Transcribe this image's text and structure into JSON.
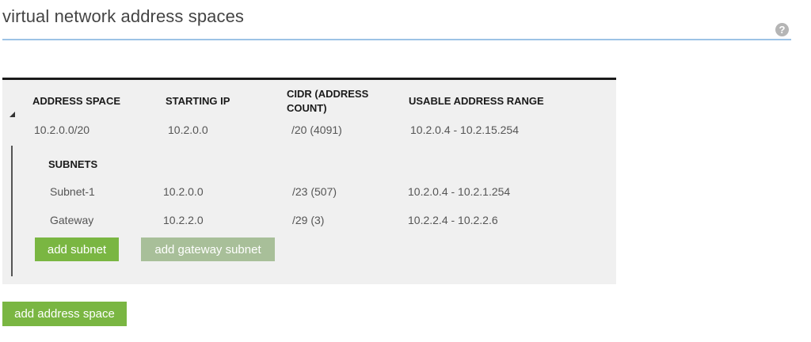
{
  "header": {
    "title": "virtual network address spaces",
    "help_icon": "?"
  },
  "colors": {
    "accent_line": "#9cc3e5",
    "button_green": "#7ab642",
    "button_disabled": "#a8bf99",
    "panel_bg": "#f0f0f0"
  },
  "table": {
    "columns": [
      "ADDRESS SPACE",
      "STARTING IP",
      "CIDR (ADDRESS COUNT)",
      "USABLE ADDRESS RANGE"
    ],
    "address_space": {
      "address": "10.2.0.0/20",
      "starting_ip": "10.2.0.0",
      "cidr": "/20 (4091)",
      "range": "10.2.0.4 - 10.2.15.254"
    },
    "subnets_label": "SUBNETS",
    "subnets": [
      {
        "name": "Subnet-1",
        "starting_ip": "10.2.0.0",
        "cidr": "/23 (507)",
        "range": "10.2.0.4 - 10.2.1.254"
      },
      {
        "name": "Gateway",
        "starting_ip": "10.2.2.0",
        "cidr": "/29 (3)",
        "range": "10.2.2.4 - 10.2.2.6"
      }
    ],
    "add_subnet_label": "add subnet",
    "add_gateway_subnet_label": "add gateway subnet"
  },
  "add_address_space_label": "add address space",
  "icons": {
    "help": "help-icon",
    "collapse": "collapse-triangle-icon"
  }
}
